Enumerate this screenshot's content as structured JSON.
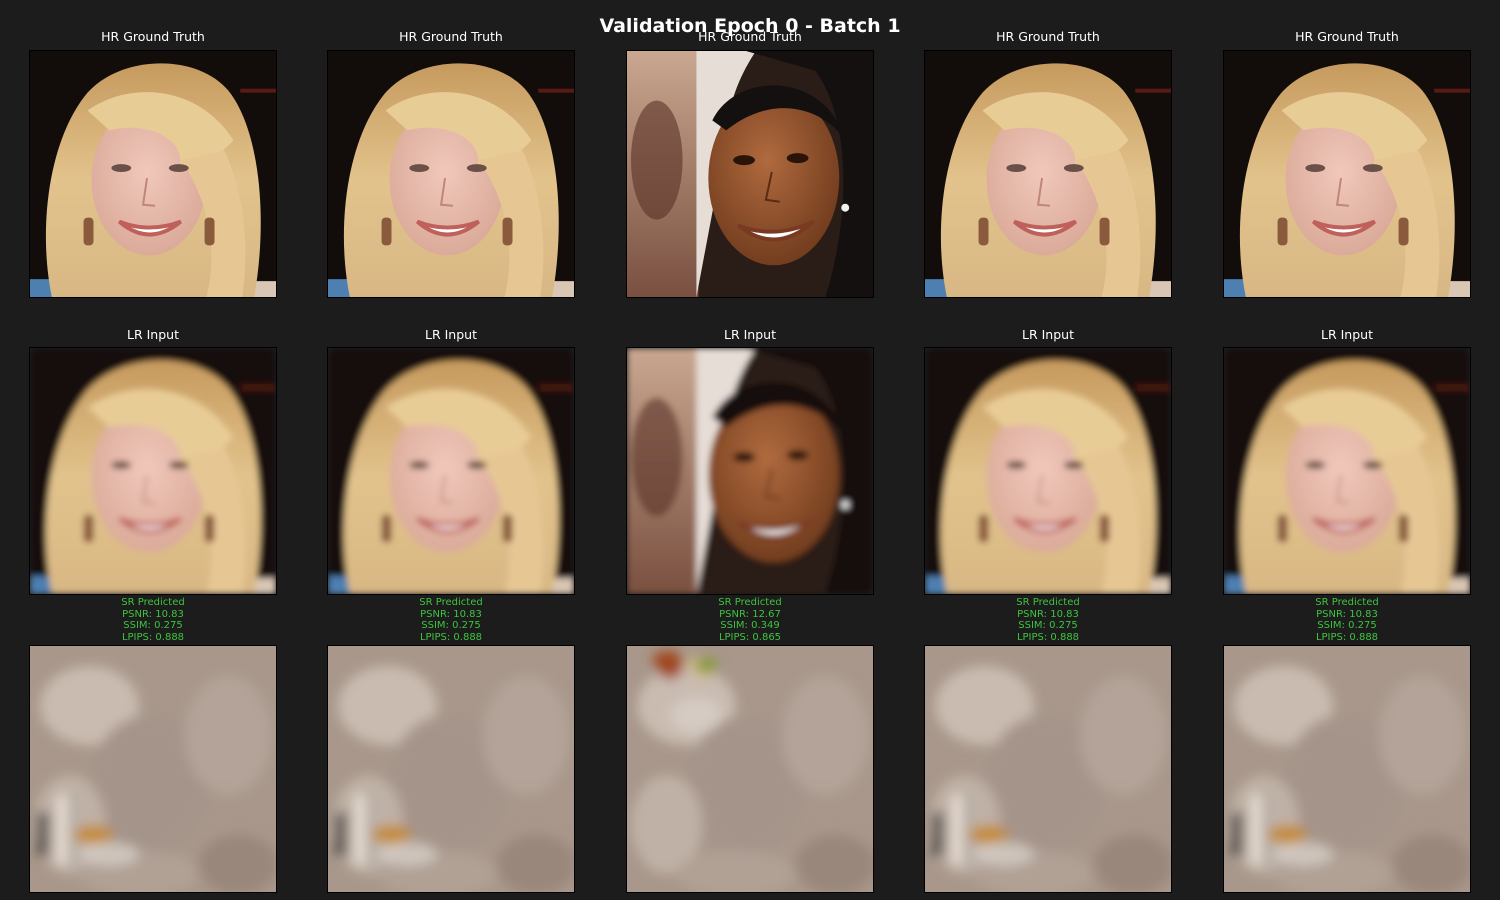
{
  "title": "Validation Epoch 0 - Batch 1",
  "colors": {
    "background": "#1c1c1c",
    "title_text": "#ffffff",
    "label_text": "#ffffff",
    "metric_text": "#3ec43e"
  },
  "rows": {
    "hr_label": "HR Ground Truth",
    "lr_label": "LR Input",
    "sr_label": "SR Predicted"
  },
  "columns": [
    {
      "subject": "blonde-woman",
      "metrics": {
        "psnr": "PSNR: 10.83",
        "ssim": "SSIM: 0.275",
        "lpips": "LPIPS: 0.888"
      }
    },
    {
      "subject": "blonde-woman",
      "metrics": {
        "psnr": "PSNR: 10.83",
        "ssim": "SSIM: 0.275",
        "lpips": "LPIPS: 0.888"
      }
    },
    {
      "subject": "dark-haired-woman",
      "metrics": {
        "psnr": "PSNR: 12.67",
        "ssim": "SSIM: 0.349",
        "lpips": "LPIPS: 0.865"
      }
    },
    {
      "subject": "blonde-woman",
      "metrics": {
        "psnr": "PSNR: 10.83",
        "ssim": "SSIM: 0.275",
        "lpips": "LPIPS: 0.888"
      }
    },
    {
      "subject": "blonde-woman",
      "metrics": {
        "psnr": "PSNR: 10.83",
        "ssim": "SSIM: 0.275",
        "lpips": "LPIPS: 0.888"
      }
    }
  ]
}
